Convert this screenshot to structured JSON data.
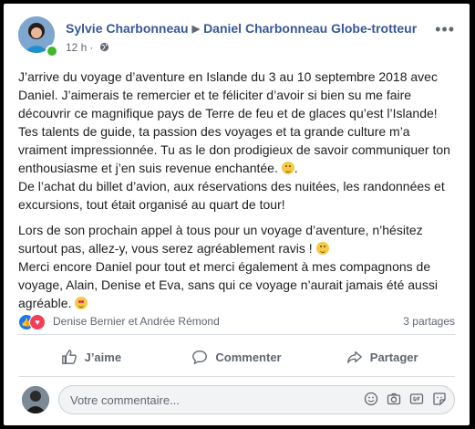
{
  "post": {
    "author": "Sylvie Charbonneau",
    "target": "Daniel Charbonneau Globe-trotteur",
    "time": "12 h",
    "privacy_icon": "globe-icon",
    "paragraphs": [
      "J’arrive du voyage d’aventure en Islande du 3 au 10 septembre 2018 avec Daniel. J’aimerais te remercier et te féliciter d’avoir si bien su me faire découvrir ce magnifique pays de Terre de feu et de glaces qu’est l’Islande! Tes talents de guide, ta passion des voyages et ta grande culture m’a vraiment impressionnée. Tu as le don prodigieux de savoir communiquer ton enthousiasme et j’en suis revenue enchantée.",
      "De l’achat du billet d’avion, aux réservations des nuitées, les randonnées et excursions, tout était organisé au quart de tour!",
      "Lors de son prochain appel à tous pour un voyage d’aventure, n’hésitez surtout pas, allez-y, vous serez agréablement ravis !",
      "Merci encore Daniel pour tout et merci également à mes compagnons de voyage, Alain, Denise et Eva, sans qui ce voyage n’aurait jamais été aussi agréable."
    ],
    "p1_tail": ".",
    "reactions_text": "Denise Bernier et Andrée Rémond",
    "shares_text": "3 partages"
  },
  "actions": {
    "like": "J’aime",
    "comment": "Commenter",
    "share": "Partager"
  },
  "comment": {
    "placeholder": "Votre commentaire..."
  }
}
